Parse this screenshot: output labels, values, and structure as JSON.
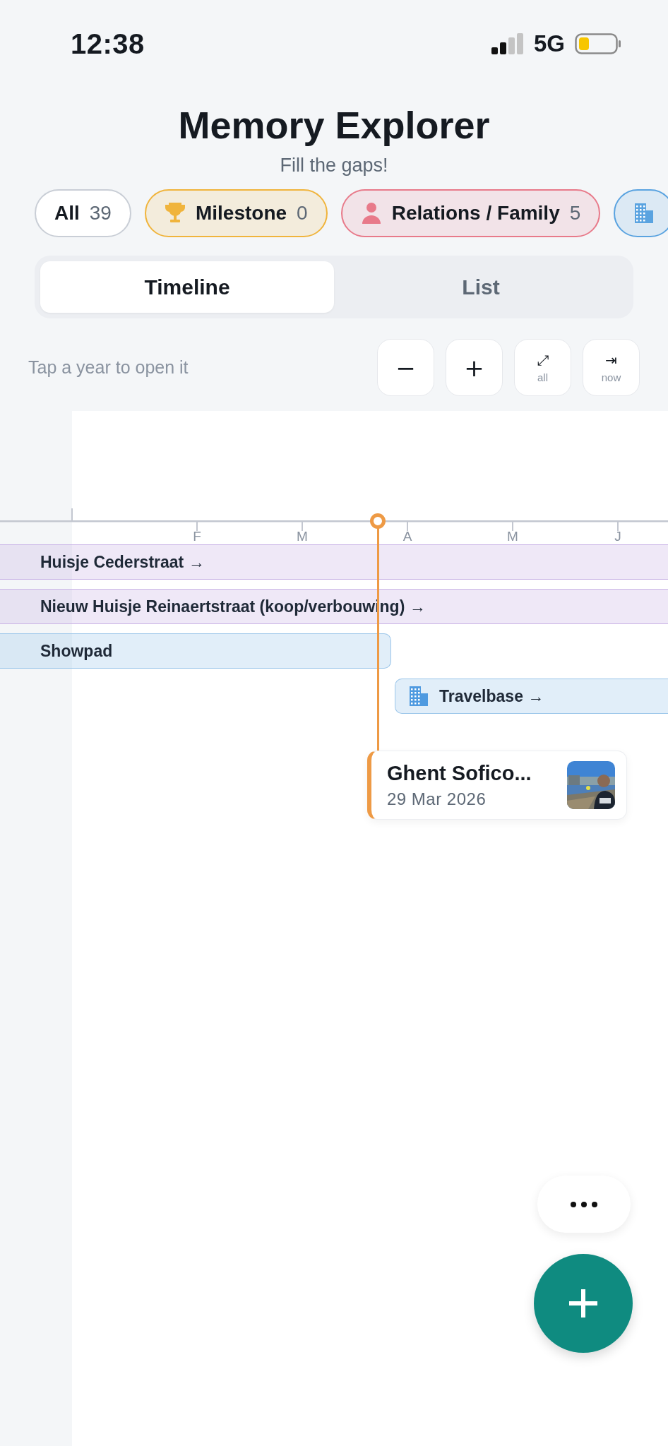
{
  "status_bar": {
    "time": "12:38",
    "network": "5G"
  },
  "header": {
    "title": "Memory Explorer",
    "subtitle": "Fill the gaps!"
  },
  "filters": [
    {
      "kind": "all",
      "label": "All",
      "count": "39",
      "color": "#c9ced6"
    },
    {
      "kind": "milestone",
      "label": "Milestone",
      "count": "0",
      "color": "#f0b43c"
    },
    {
      "kind": "relations",
      "label": "Relations / Family",
      "count": "5",
      "color": "#e87a8a"
    },
    {
      "kind": "work",
      "color": "#5aa3e0"
    }
  ],
  "tabs": [
    {
      "label": "Timeline",
      "selected": true
    },
    {
      "label": "List",
      "selected": false
    }
  ],
  "hint": "Tap a year to open it",
  "controls": [
    {
      "kind": "zoom_out",
      "symbol": "−"
    },
    {
      "kind": "zoom_in",
      "symbol": "+"
    },
    {
      "kind": "fit",
      "symbol": "⤢",
      "label": "all"
    },
    {
      "kind": "now",
      "symbol": "⇥",
      "label": "now"
    }
  ],
  "timeline": {
    "months": [
      "F",
      "M",
      "A",
      "M",
      "J"
    ],
    "bars": [
      {
        "label": "Huisje Cederstraat →",
        "color": "#c9b3e6"
      },
      {
        "label": "Nieuw Huisje Reinaertstraat (koop/verbouwing) →",
        "color": "#c9b3e6"
      },
      {
        "label": "Showpad",
        "color": "#9cc6ea"
      },
      {
        "label": "Travelbase →",
        "color": "#9cc6ea",
        "kind": "building"
      }
    ],
    "event": {
      "title": "Ghent Sofico...",
      "date": "29 Mar 2026",
      "color": "#ee9a45",
      "kind": "picture"
    }
  }
}
